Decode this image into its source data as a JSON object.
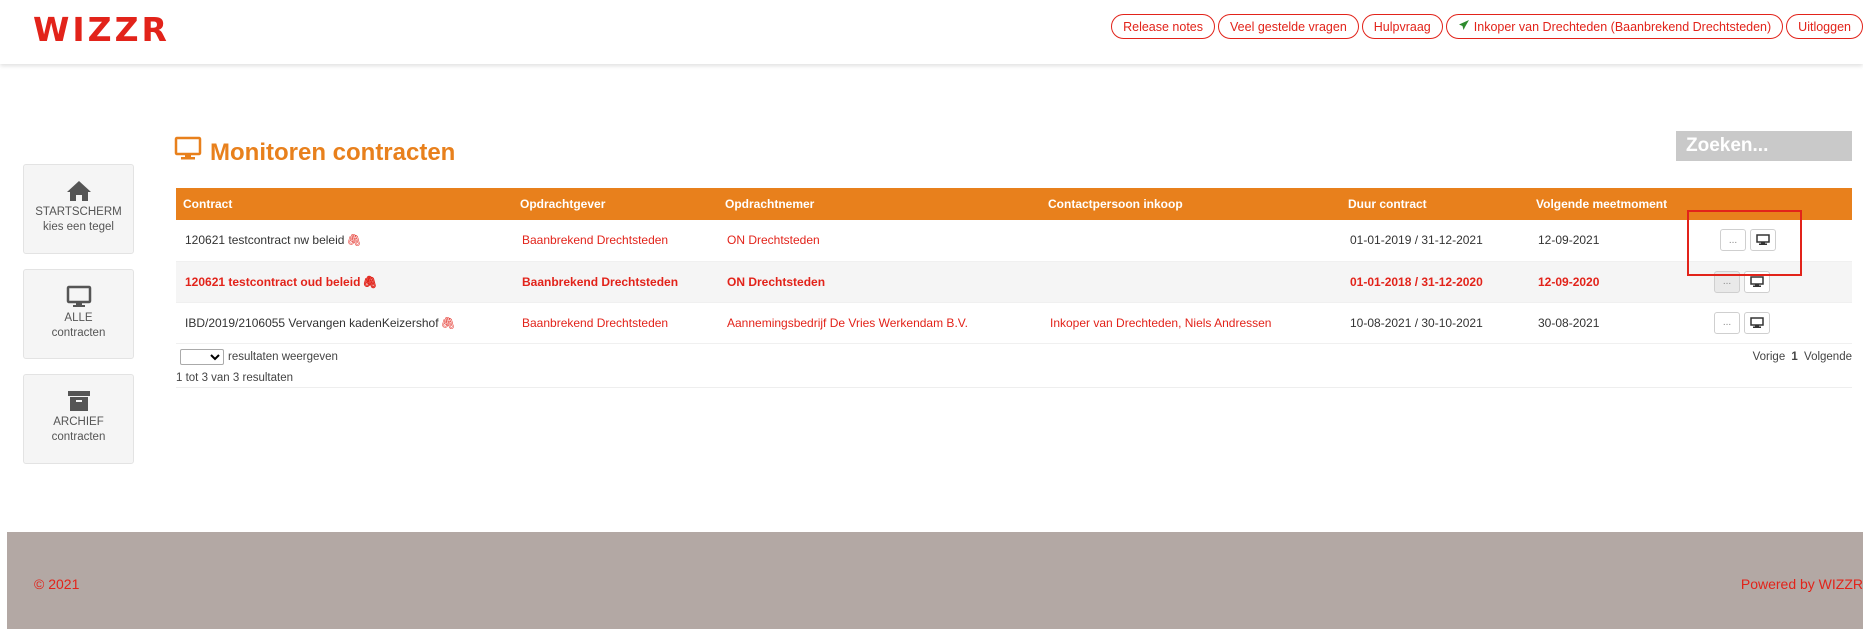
{
  "header": {
    "logo": "WIZZR",
    "nav": [
      {
        "label": "Release notes"
      },
      {
        "label": "Veel gestelde vragen"
      },
      {
        "label": "Hulpvraag"
      },
      {
        "label": "Inkoper van Drechteden (Baanbrekend Drechtsteden)",
        "icon": "paper-plane-icon"
      },
      {
        "label": "Uitloggen"
      }
    ]
  },
  "sidebar": {
    "tiles": [
      {
        "line1": "STARTSCHERM",
        "line2": "kies een tegel",
        "icon": "home-icon"
      },
      {
        "line1": "ALLE",
        "line2": "contracten",
        "icon": "monitor-icon"
      },
      {
        "line1": "ARCHIEF",
        "line2": "contracten",
        "icon": "archive-icon"
      }
    ]
  },
  "page": {
    "title": "Monitoren contracten",
    "search_placeholder": "Zoeken..."
  },
  "table": {
    "columns": [
      "Contract",
      "Opdrachtgever",
      "Opdrachtnemer",
      "Contactpersoon inkoop",
      "Duur contract",
      "Volgende meetmoment"
    ],
    "rows": [
      {
        "contract": "120621 testcontract nw beleid",
        "opdrachtgever": "Baanbrekend Drechtsteden",
        "opdrachtnemer": "ON Drechtsteden",
        "contactpersoon": "",
        "duur": "01-01-2019 / 31-12-2021",
        "meetmoment": "12-09-2021",
        "actions_label": "..."
      },
      {
        "contract": "120621 testcontract oud beleid",
        "opdrachtgever": "Baanbrekend Drechtsteden",
        "opdrachtnemer": "ON Drechtsteden",
        "contactpersoon": "",
        "duur": "01-01-2018 / 31-12-2020",
        "meetmoment": "12-09-2020",
        "actions_label": "..."
      },
      {
        "contract": "IBD/2019/2106055 Vervangen kadenKeizershof",
        "opdrachtgever": "Baanbrekend Drechtsteden",
        "opdrachtnemer": "Aannemingsbedrijf De Vries Werkendam B.V.",
        "contactpersoon": "Inkoper van Drechteden, Niels Andressen",
        "duur": "10-08-2021 / 30-10-2021",
        "meetmoment": "30-08-2021",
        "actions_label": "..."
      }
    ],
    "page_size_label": "resultaten weergeven",
    "count_label": "1 tot 3 van 3 resultaten",
    "pager": {
      "prev": "Vorige",
      "current": "1",
      "next": "Volgende"
    }
  },
  "footer": {
    "copyright": "© 2021",
    "powered": "Powered by WIZZR"
  },
  "colors": {
    "brand_red": "#e2231a",
    "accent_orange": "#e8801c",
    "footer_bg": "#b3a8a4"
  }
}
